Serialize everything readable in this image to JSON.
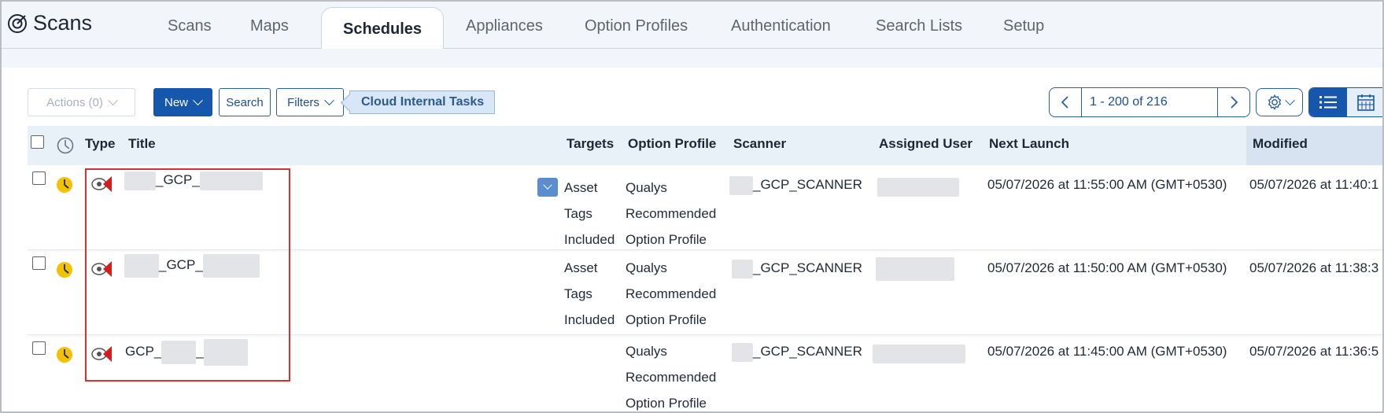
{
  "app": {
    "title": "Scans"
  },
  "tabs": [
    {
      "label": "Scans"
    },
    {
      "label": "Maps"
    },
    {
      "label": "Schedules"
    },
    {
      "label": "Appliances"
    },
    {
      "label": "Option Profiles"
    },
    {
      "label": "Authentication"
    },
    {
      "label": "Search Lists"
    },
    {
      "label": "Setup"
    }
  ],
  "toolbar": {
    "actions_label": "Actions (0)",
    "new_label": "New",
    "search_label": "Search",
    "filters_label": "Filters",
    "filter_tag": "Cloud Internal Tasks",
    "pagination": "1 - 200 of 216"
  },
  "table": {
    "columns": {
      "type": "Type",
      "title": "Title",
      "targets": "Targets",
      "option_profile": "Option Profile",
      "scanner": "Scanner",
      "assigned_user": "Assigned User",
      "next_launch": "Next Launch",
      "modified": "Modified"
    },
    "rows": [
      {
        "title_mid": "_GCP_",
        "targets": [
          "Asset",
          "Tags",
          "Included"
        ],
        "option_profile": [
          "Qualys",
          "Recommended",
          "Option Profile"
        ],
        "scanner": "_GCP_SCANNER",
        "next_launch": "05/07/2026 at 11:55:00 AM (GMT+0530)",
        "modified": "05/07/2026 at 11:40:1"
      },
      {
        "title_mid": "_GCP_",
        "targets": [
          "Asset",
          "Tags",
          "Included"
        ],
        "option_profile": [
          "Qualys",
          "Recommended",
          "Option Profile"
        ],
        "scanner": "_GCP_SCANNER",
        "next_launch": "05/07/2026 at 11:50:00 AM (GMT+0530)",
        "modified": "05/07/2026 at 11:38:3"
      },
      {
        "title_mid": "GCP_",
        "targets": [],
        "option_profile": [
          "Qualys",
          "Recommended",
          "Option Profile"
        ],
        "scanner": "_GCP_SCANNER",
        "next_launch": "05/07/2026 at 11:45:00 AM (GMT+0530)",
        "modified": "05/07/2026 at 11:36:5"
      }
    ]
  },
  "colors": {
    "accent": "#1657ad",
    "highlight": "#d93131",
    "clock": "#f2c200"
  }
}
